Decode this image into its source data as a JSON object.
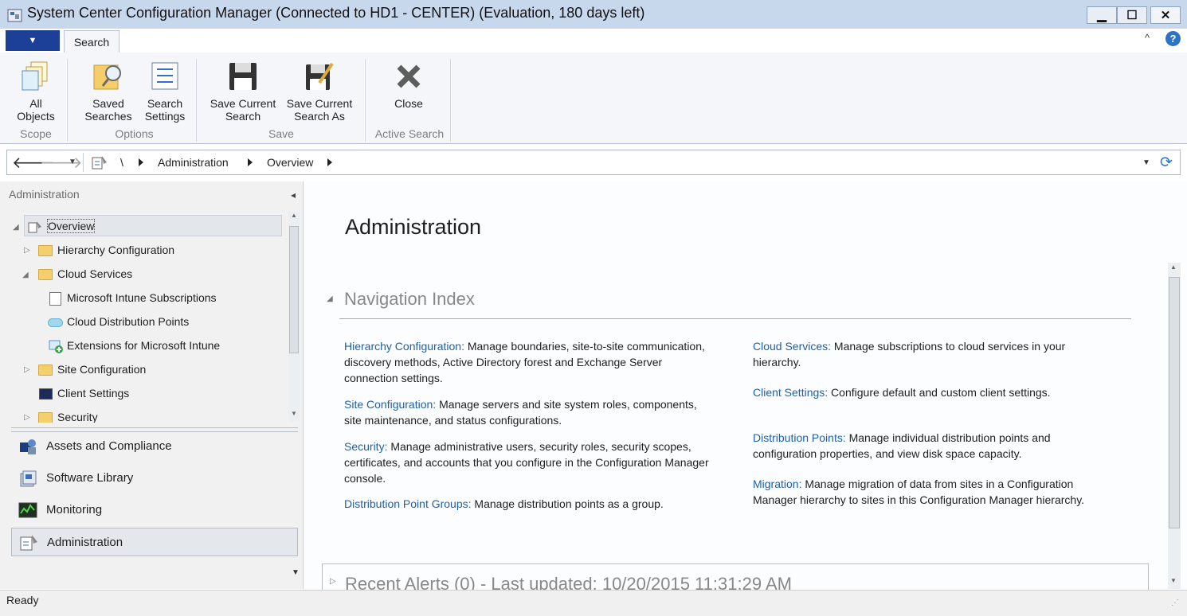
{
  "window": {
    "title": "System Center Configuration Manager (Connected to HD1 - CENTER) (Evaluation, 180 days left)"
  },
  "ribbon": {
    "tab": "Search",
    "groups": {
      "scope": "Scope",
      "options": "Options",
      "save": "Save",
      "active_search": "Active Search"
    },
    "buttons": {
      "all_objects": "All\nObjects",
      "saved_searches": "Saved\nSearches",
      "search_settings": "Search\nSettings",
      "save_current_search": "Save Current\nSearch",
      "save_current_search_as": "Save Current\nSearch As",
      "close": "Close"
    }
  },
  "address": {
    "root": "\\",
    "crumbs": [
      "Administration",
      "Overview"
    ]
  },
  "left_pane": {
    "header": "Administration",
    "tree": [
      "Overview",
      "Hierarchy Configuration",
      "Cloud Services",
      "Microsoft Intune Subscriptions",
      "Cloud Distribution Points",
      "Extensions for Microsoft Intune",
      "Site Configuration",
      "Client Settings",
      "Security"
    ],
    "workspaces": [
      "Assets and Compliance",
      "Software Library",
      "Monitoring",
      "Administration"
    ]
  },
  "main": {
    "title": "Administration",
    "nav_index_title": "Navigation Index",
    "left_items": [
      {
        "link": "Hierarchy Configuration:",
        "text": " Manage boundaries, site-to-site communication, discovery methods, Active Directory forest and Exchange Server connection settings."
      },
      {
        "link": "Site Configuration:",
        "text": " Manage servers and site system roles, components, site maintenance, and status configurations."
      },
      {
        "link": "Security:",
        "text": " Manage administrative users, security roles, security scopes, certificates, and accounts that you configure in the Configuration Manager console."
      },
      {
        "link": "Distribution Point Groups:",
        "text": " Manage distribution points as a group."
      }
    ],
    "right_items": [
      {
        "link": "Cloud Services:",
        "text": " Manage subscriptions to cloud services in your hierarchy."
      },
      {
        "link": "Client Settings:",
        "text": " Configure default and custom client settings."
      },
      {
        "link": "Distribution Points:",
        "text": " Manage individual distribution points and configuration properties, and view disk space capacity."
      },
      {
        "link": "Migration:",
        "text": " Manage migration of data from sites in a Configuration Manager hierarchy to sites in this Configuration Manager hierarchy."
      }
    ],
    "recent_alerts": "Recent Alerts (0) - Last updated: 10/20/2015 11:31:29 AM"
  },
  "status": {
    "text": "Ready"
  },
  "colors": {
    "accent": "#1c3f97",
    "link": "#1f5fa8",
    "titlebar": "#c7d7ec"
  }
}
